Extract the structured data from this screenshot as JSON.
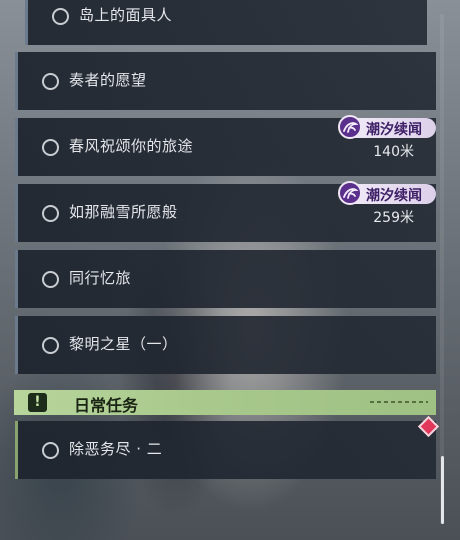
{
  "quests": [
    {
      "title": "岛上的面具人",
      "tag": "",
      "distance": ""
    },
    {
      "title": "奏者的愿望",
      "tag": "",
      "distance": ""
    },
    {
      "title": "春风祝颂你的旅途",
      "tag": "潮汐续闻",
      "distance": "140米"
    },
    {
      "title": "如那融雪所愿般",
      "tag": "潮汐续闻",
      "distance": "259米"
    },
    {
      "title": "同行忆旅",
      "tag": "",
      "distance": ""
    },
    {
      "title": "黎明之星（一）",
      "tag": "",
      "distance": ""
    }
  ],
  "daily_section": {
    "icon": "exclamation-icon",
    "icon_glyph": "!",
    "title": "日常任务"
  },
  "daily_quests": [
    {
      "title": "除恶务尽 · 二"
    }
  ],
  "colors": {
    "tag_bg": "#ece2f4",
    "tag_text": "#3d1f66",
    "daily_header": "#b0cf94",
    "marker": "#e0375a"
  }
}
